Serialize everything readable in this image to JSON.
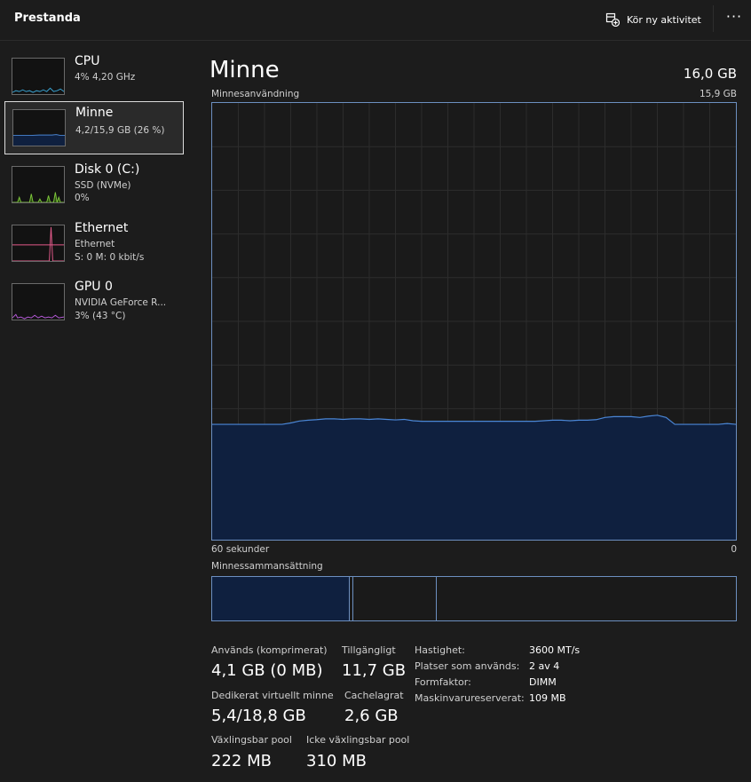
{
  "header": {
    "title": "Prestanda",
    "run_task_label": "Kör ny aktivitet",
    "more_label": "···"
  },
  "sidebar": {
    "items": [
      {
        "title": "CPU",
        "line1": "4%  4,20 GHz",
        "line2": "",
        "color": "#3aa6d6"
      },
      {
        "title": "Minne",
        "line1": "4,2/15,9 GB (26 %)",
        "line2": "",
        "color": "#4a86d6"
      },
      {
        "title": "Disk 0 (C:)",
        "line1": "SSD (NVMe)",
        "line2": "0%",
        "color": "#7cc53a"
      },
      {
        "title": "Ethernet",
        "line1": "Ethernet",
        "line2": "S: 0  M: 0 kbit/s",
        "color": "#e35a8a"
      },
      {
        "title": "GPU 0",
        "line1": "NVIDIA GeForce R...",
        "line2": "3%  (43 °C)",
        "color": "#b459d6"
      }
    ]
  },
  "main": {
    "title": "Minne",
    "total": "16,0 GB",
    "usage_label": "Minnesanvändning",
    "usage_max": "15,9 GB",
    "x_start_label": "60 sekunder",
    "x_end_label": "0",
    "composition_label": "Minnessammansättning"
  },
  "stats": {
    "in_use_label": "Används (komprimerat)",
    "in_use_value": "4,1 GB (0 MB)",
    "available_label": "Tillgängligt",
    "available_value": "11,7 GB",
    "committed_label": "Dedikerat virtuellt minne",
    "committed_value": "5,4/18,8 GB",
    "cached_label": "Cachelagrat",
    "cached_value": "2,6 GB",
    "paged_label": "Växlingsbar pool",
    "paged_value": "222 MB",
    "nonpaged_label": "Icke växlingsbar pool",
    "nonpaged_value": "310 MB"
  },
  "details": [
    {
      "label": "Hastighet:",
      "value": "3600 MT/s"
    },
    {
      "label": "Platser som används:",
      "value": "2 av 4"
    },
    {
      "label": "Formfaktor:",
      "value": "DIMM"
    },
    {
      "label": "Maskinvarureserverat:",
      "value": "109 MB"
    }
  ],
  "colors": {
    "accent": "#6c8fc0",
    "fill": "#0f203f",
    "background": "#1c1c1c"
  },
  "chart_data": {
    "type": "area",
    "title": "Minnesanvändning",
    "xlabel": "60 sekunder",
    "ylabel": "",
    "xlim": [
      60,
      0
    ],
    "ylim": [
      0,
      15.9
    ],
    "x": [
      60,
      59,
      58,
      57,
      56,
      55,
      54,
      53,
      52,
      51,
      50,
      49,
      48,
      47,
      46,
      45,
      44,
      43,
      42,
      41,
      40,
      39,
      38,
      37,
      36,
      35,
      34,
      33,
      32,
      31,
      30,
      29,
      28,
      27,
      26,
      25,
      24,
      23,
      22,
      21,
      20,
      19,
      18,
      17,
      16,
      15,
      14,
      13,
      12,
      11,
      10,
      9,
      8,
      7,
      6,
      5,
      4,
      3,
      2,
      1,
      0
    ],
    "series": [
      {
        "values": [
          4.2,
          4.2,
          4.2,
          4.2,
          4.2,
          4.2,
          4.2,
          4.2,
          4.2,
          4.25,
          4.32,
          4.35,
          4.37,
          4.4,
          4.4,
          4.38,
          4.4,
          4.4,
          4.38,
          4.4,
          4.38,
          4.36,
          4.38,
          4.33,
          4.31,
          4.31,
          4.31,
          4.31,
          4.31,
          4.31,
          4.31,
          4.31,
          4.31,
          4.31,
          4.31,
          4.31,
          4.31,
          4.31,
          4.33,
          4.35,
          4.35,
          4.33,
          4.35,
          4.35,
          4.37,
          4.45,
          4.48,
          4.48,
          4.48,
          4.45,
          4.5,
          4.53,
          4.45,
          4.2,
          4.2,
          4.2,
          4.2,
          4.2,
          4.2,
          4.23,
          4.2
        ]
      }
    ]
  }
}
